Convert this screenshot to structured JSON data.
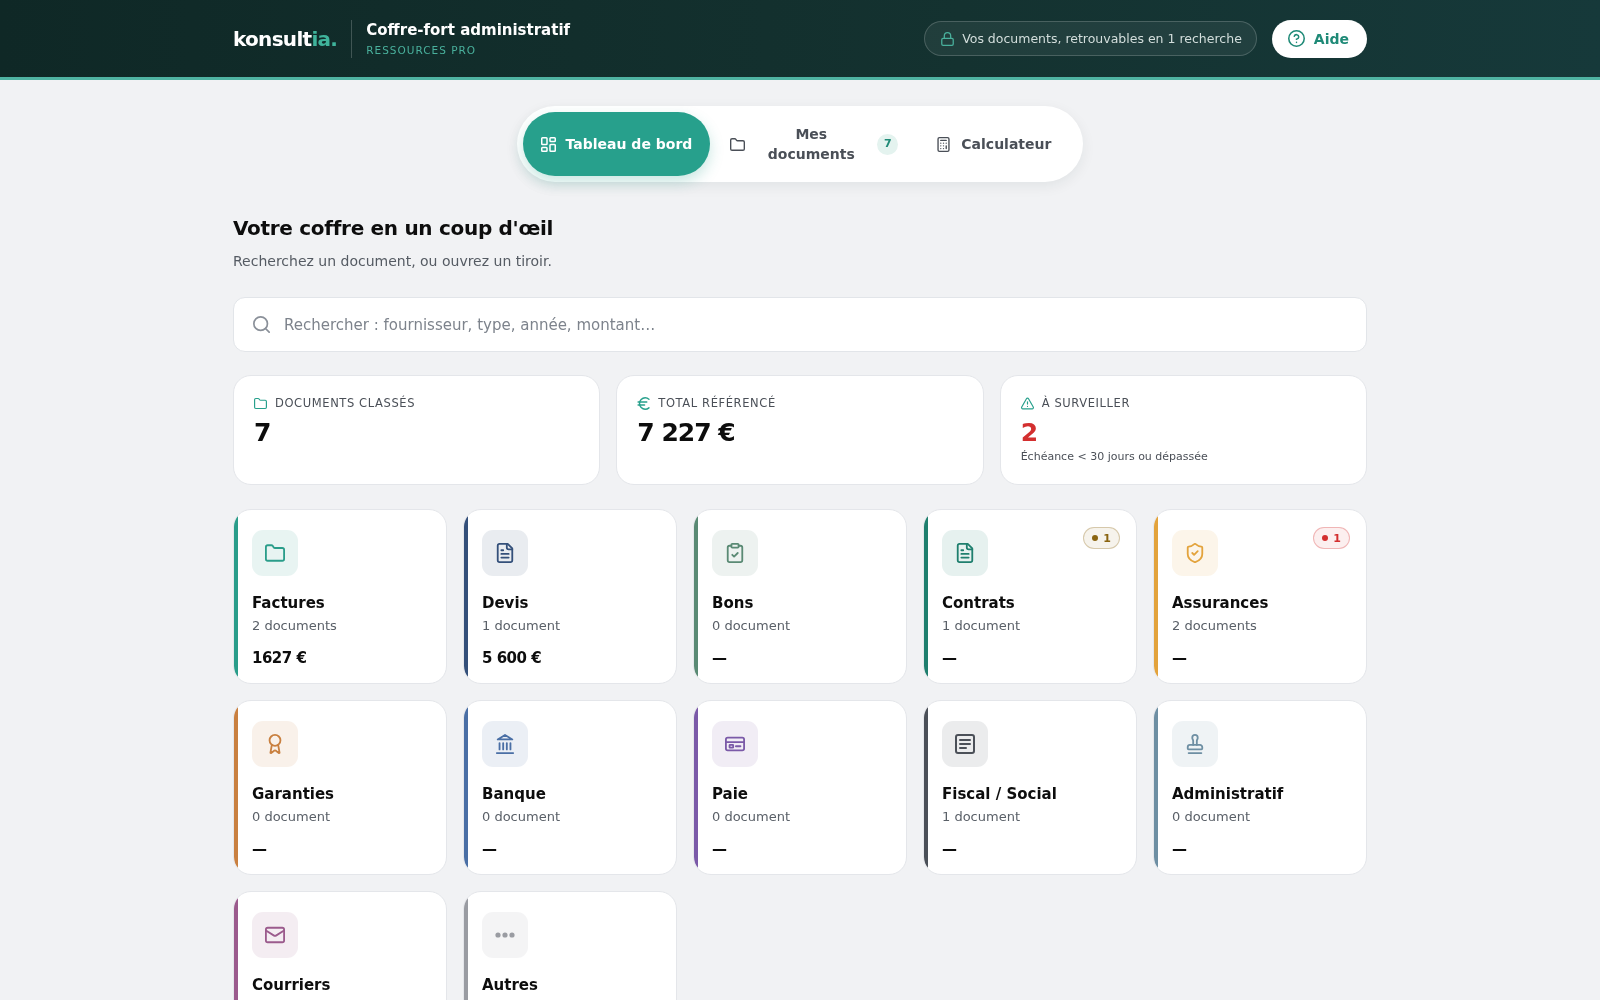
{
  "header": {
    "logo": {
      "text": "konsult",
      "accent": "ia."
    },
    "title": "Coffre-fort administratif",
    "subtitle": "RESSOURCES PRO",
    "tagline": "Vos documents, retrouvables en 1 recherche",
    "help_button": "Aide"
  },
  "tabs": [
    {
      "label": "Tableau de bord",
      "selected": true
    },
    {
      "label": "Mes documents",
      "selected": false,
      "badge": "7"
    },
    {
      "label": "Calculateur",
      "selected": false
    }
  ],
  "overview": {
    "title": "Votre coffre en un coup d'œil",
    "subtitle": "Recherchez un document, ou ouvrez un tiroir."
  },
  "search": {
    "placeholder": "Rechercher : fournisseur, type, année, montant…"
  },
  "stats": [
    {
      "label": "DOCUMENTS CLASSÉS",
      "value": "7",
      "alert": false
    },
    {
      "label": "TOTAL RÉFÉRENCÉ",
      "value": "7 227 €",
      "alert": false
    },
    {
      "label": "À SURVEILLER",
      "value": "2",
      "alert": true,
      "note": "Échéance < 30 jours ou dépassée"
    }
  ],
  "categories": [
    {
      "title": "Factures",
      "count": "2 documents",
      "amount": "1627 €",
      "color": "#2a9d8a"
    },
    {
      "title": "Devis",
      "count": "1 document",
      "amount": "5 600 €",
      "color": "#34507a"
    },
    {
      "title": "Bons",
      "count": "0 document",
      "amount": "—",
      "color": "#5a8a74"
    },
    {
      "title": "Contrats",
      "count": "1 document",
      "amount": "—",
      "color": "#1f7f6e",
      "badge": {
        "text": "1",
        "color": "#8a6410"
      }
    },
    {
      "title": "Assurances",
      "count": "2 documents",
      "amount": "—",
      "color": "#e3a33c",
      "badge": {
        "text": "1",
        "color": "#d32f2f"
      }
    },
    {
      "title": "Garanties",
      "count": "0 document",
      "amount": "—",
      "color": "#c98040"
    },
    {
      "title": "Banque",
      "count": "0 document",
      "amount": "—",
      "color": "#4a6fa5"
    },
    {
      "title": "Paie",
      "count": "0 document",
      "amount": "—",
      "color": "#7b5aa8"
    },
    {
      "title": "Fiscal / Social",
      "count": "1 document",
      "amount": "—",
      "color": "#4b5058"
    },
    {
      "title": "Administratif",
      "count": "0 document",
      "amount": "—",
      "color": "#6e8fa3"
    },
    {
      "title": "Courriers",
      "color": "#9b5b8d"
    },
    {
      "title": "Autres",
      "color": "#9a9ca2"
    }
  ]
}
